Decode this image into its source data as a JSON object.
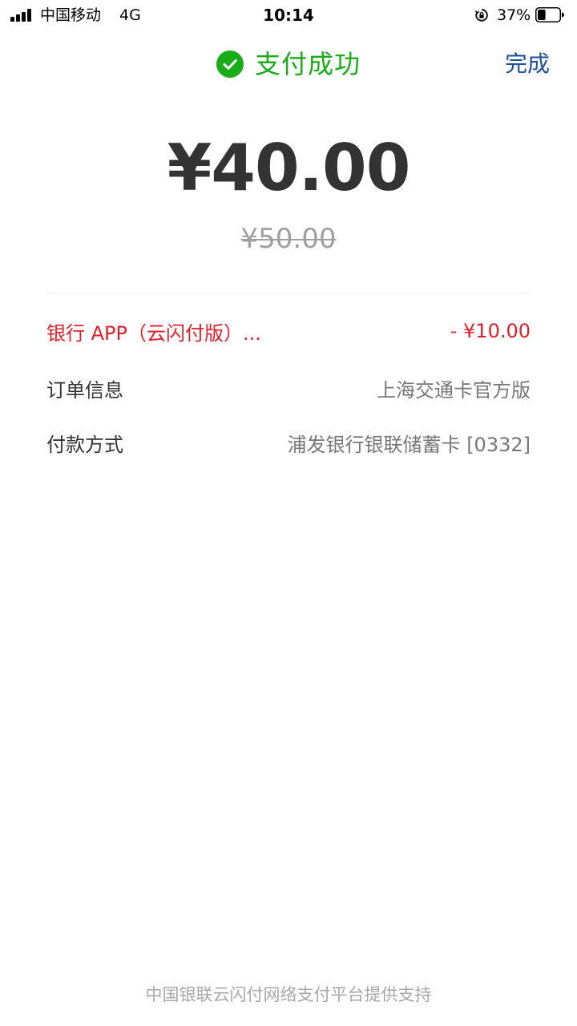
{
  "status_bar": {
    "carrier": "中国移动",
    "network": "4G",
    "time": "10:14",
    "battery_percent": "37%",
    "battery_level": 0.37
  },
  "header": {
    "title": "支付成功",
    "done_label": "完成",
    "title_color": "#1aad19",
    "done_color": "#1b4f9b"
  },
  "payment": {
    "amount_paid": "¥40.00",
    "original_amount": "¥50.00"
  },
  "details": {
    "discount": {
      "label": "银行 APP（云闪付版）...",
      "value": "- ¥10.00",
      "color": "#e0202a"
    },
    "order": {
      "label": "订单信息",
      "value": "上海交通卡官方版"
    },
    "payment_method": {
      "label": "付款方式",
      "value": "浦发银行银联储蓄卡 [0332]"
    }
  },
  "footer": {
    "text": "中国银联云闪付网络支付平台提供支持"
  }
}
